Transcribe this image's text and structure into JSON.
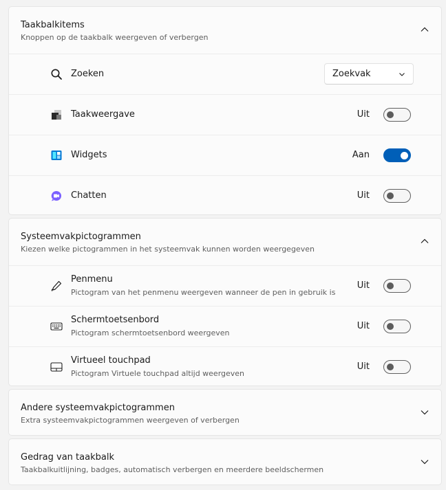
{
  "taskbar_items": {
    "title": "Taakbalkitems",
    "subtitle": "Knoppen op de taakbalk weergeven of verbergen",
    "search": {
      "label": "Zoeken",
      "dropdown_value": "Zoekvak"
    },
    "task_view": {
      "label": "Taakweergave",
      "state": "Uit",
      "on": false
    },
    "widgets": {
      "label": "Widgets",
      "state": "Aan",
      "on": true
    },
    "chat": {
      "label": "Chatten",
      "state": "Uit",
      "on": false
    }
  },
  "system_tray": {
    "title": "Systeemvakpictogrammen",
    "subtitle": "Kiezen welke pictogrammen in het systeemvak kunnen worden weergegeven",
    "pen_menu": {
      "label": "Penmenu",
      "desc": "Pictogram van het penmenu weergeven wanneer de pen in gebruik is",
      "state": "Uit",
      "on": false
    },
    "touch_keyboard": {
      "label": "Schermtoetsenbord",
      "desc": "Pictogram schermtoetsenbord weergeven",
      "state": "Uit",
      "on": false
    },
    "virtual_touchpad": {
      "label": "Virtueel touchpad",
      "desc": "Pictogram Virtuele touchpad altijd weergeven",
      "state": "Uit",
      "on": false
    }
  },
  "other_tray": {
    "title": "Andere systeemvakpictogrammen",
    "subtitle": "Extra systeemvakpictogrammen weergeven of verbergen"
  },
  "behavior": {
    "title": "Gedrag van taakbalk",
    "subtitle": "Taakbalkuitlijning, badges, automatisch verbergen en meerdere beeldschermen"
  },
  "colors": {
    "accent": "#005fb8",
    "widgets_blue": "#0078d4",
    "widgets_cyan": "#50e6ff",
    "chat_purple": "#7b61ff"
  }
}
